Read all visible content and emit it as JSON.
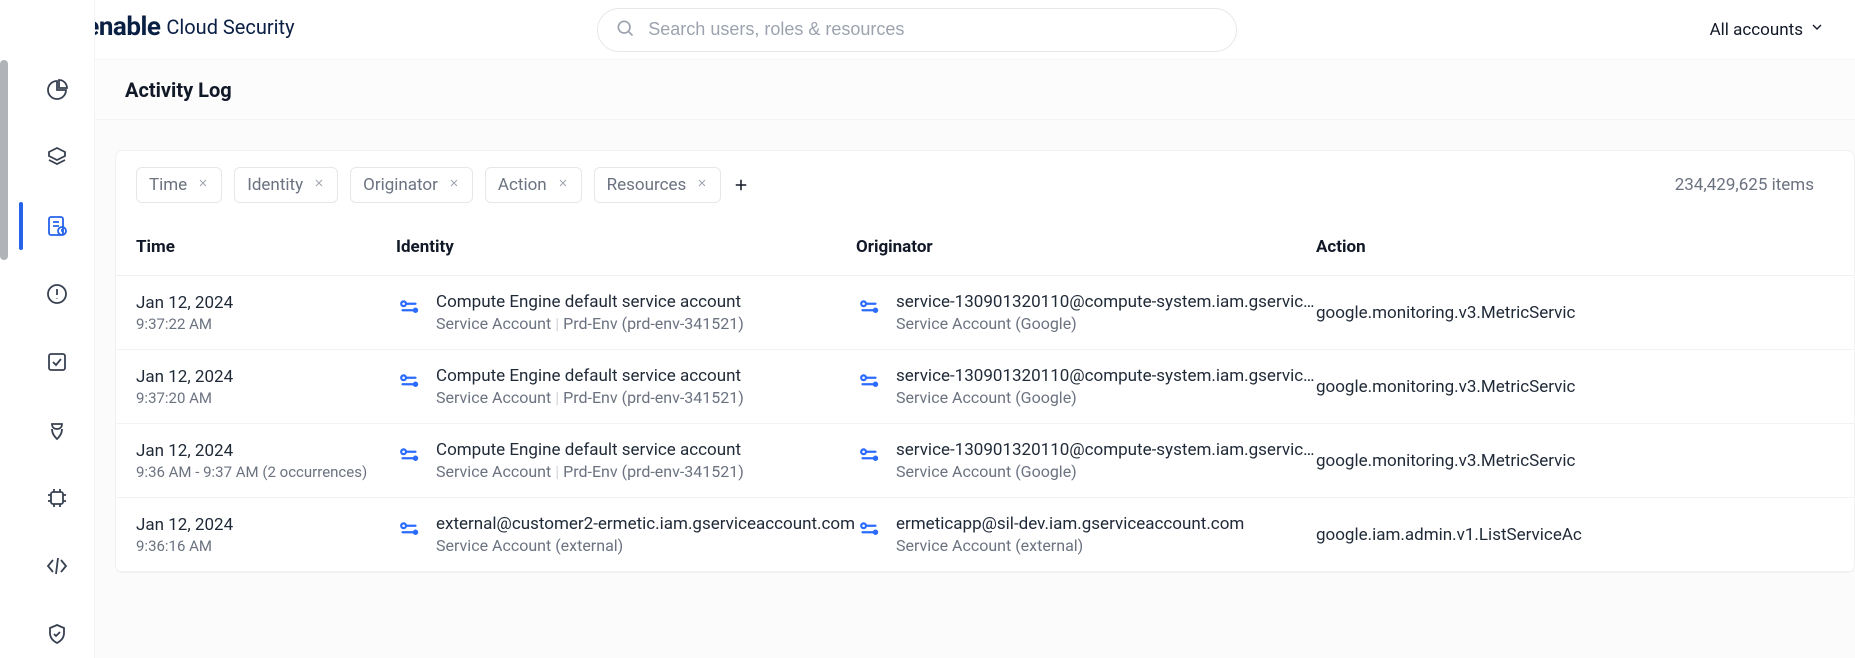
{
  "brand": {
    "name": "tenable",
    "suffix": "Cloud Security"
  },
  "search": {
    "placeholder": "Search users, roles & resources"
  },
  "account_selector": {
    "label": "All accounts"
  },
  "page": {
    "title": "Activity Log"
  },
  "filters": [
    {
      "label": "Time"
    },
    {
      "label": "Identity"
    },
    {
      "label": "Originator"
    },
    {
      "label": "Action"
    },
    {
      "label": "Resources"
    }
  ],
  "items_count": "234,429,625 items",
  "columns": {
    "time": "Time",
    "identity": "Identity",
    "originator": "Originator",
    "action": "Action"
  },
  "rows": [
    {
      "date": "Jan 12, 2024",
      "time": "9:37:22 AM",
      "identity_name": "Compute Engine default service account",
      "identity_type": "Service Account",
      "identity_env": "Prd-Env (prd-env-341521)",
      "originator_name": "service-130901320110@compute-system.iam.gservic…",
      "originator_type": "Service Account (Google)",
      "action": "google.monitoring.v3.MetricServic"
    },
    {
      "date": "Jan 12, 2024",
      "time": "9:37:20 AM",
      "identity_name": "Compute Engine default service account",
      "identity_type": "Service Account",
      "identity_env": "Prd-Env (prd-env-341521)",
      "originator_name": "service-130901320110@compute-system.iam.gservic…",
      "originator_type": "Service Account (Google)",
      "action": "google.monitoring.v3.MetricServic"
    },
    {
      "date": "Jan 12, 2024",
      "time": "9:36 AM - 9:37 AM (2 occurrences)",
      "identity_name": "Compute Engine default service account",
      "identity_type": "Service Account",
      "identity_env": "Prd-Env (prd-env-341521)",
      "originator_name": "service-130901320110@compute-system.iam.gservic…",
      "originator_type": "Service Account (Google)",
      "action": "google.monitoring.v3.MetricServic"
    },
    {
      "date": "Jan 12, 2024",
      "time": "9:36:16 AM",
      "identity_name": "external@customer2-ermetic.iam.gserviceaccount.com",
      "identity_type": "Service Account (external)",
      "identity_env": "",
      "originator_name": "ermeticapp@sil-dev.iam.gserviceaccount.com",
      "originator_type": "Service Account (external)",
      "action": "google.iam.admin.v1.ListServiceAc"
    }
  ]
}
